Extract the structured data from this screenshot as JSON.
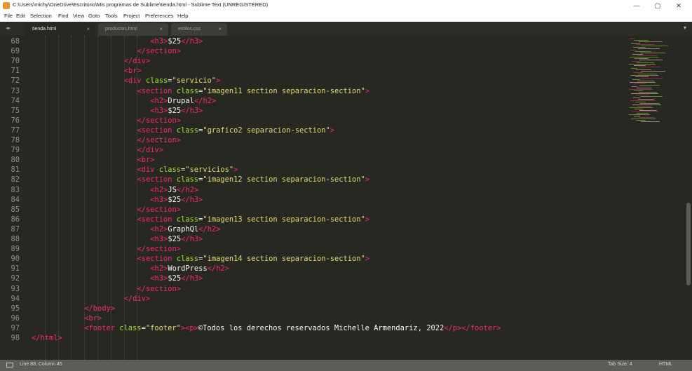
{
  "window": {
    "title": "C:\\Users\\michy\\OneDrive\\Escritorio\\Mis programas de Sublime\\tienda.html - Sublime Text (UNREGISTERED)",
    "minimize": "—",
    "maximize": "▢",
    "close": "✕"
  },
  "menu": [
    "File",
    "Edit",
    "Selection",
    "Find",
    "View",
    "Goto",
    "Tools",
    "Project",
    "Preferences",
    "Help"
  ],
  "tabs": [
    {
      "label": "tienda.html",
      "active": true
    },
    {
      "label": "productos.html",
      "active": false
    },
    {
      "label": "estilos.css",
      "active": false
    }
  ],
  "tab_close_glyph": "×",
  "tab_nav": "◂ ▸",
  "tab_menu": "▾",
  "line_numbers": [
    "68",
    "69",
    "70",
    "71",
    "72",
    "73",
    "74",
    "75",
    "76",
    "77",
    "78",
    "79",
    "80",
    "81",
    "82",
    "83",
    "84",
    "85",
    "86",
    "87",
    "88",
    "89",
    "90",
    "91",
    "92",
    "93",
    "94",
    "95",
    "96",
    "97",
    "98"
  ],
  "code_lines": [
    {
      "indent": 9,
      "tokens": [
        [
          "tg",
          "<h3>"
        ],
        [
          "tx",
          "$25"
        ],
        [
          "tg",
          "</h3>"
        ]
      ]
    },
    {
      "indent": 8,
      "tokens": [
        [
          "tg",
          "</section>"
        ]
      ]
    },
    {
      "indent": 7,
      "tokens": [
        [
          "tg",
          "</div>"
        ]
      ]
    },
    {
      "indent": 7,
      "tokens": [
        [
          "tg",
          "<br>"
        ]
      ]
    },
    {
      "indent": 7,
      "tokens": [
        [
          "tg",
          "<div "
        ],
        [
          "at",
          "class"
        ],
        [
          "tx",
          "="
        ],
        [
          "st",
          "\"servicio\""
        ],
        [
          "tg",
          ">"
        ]
      ]
    },
    {
      "indent": 8,
      "tokens": [
        [
          "tg",
          "<section "
        ],
        [
          "at",
          "class"
        ],
        [
          "tx",
          "="
        ],
        [
          "st",
          "\"imagen11 section separacion-section\""
        ],
        [
          "tg",
          ">"
        ]
      ]
    },
    {
      "indent": 9,
      "tokens": [
        [
          "tg",
          "<h2>"
        ],
        [
          "tx",
          "Drupal"
        ],
        [
          "tg",
          "</h2>"
        ]
      ]
    },
    {
      "indent": 9,
      "tokens": [
        [
          "tg",
          "<h3>"
        ],
        [
          "tx",
          "$25"
        ],
        [
          "tg",
          "</h3>"
        ]
      ]
    },
    {
      "indent": 8,
      "tokens": [
        [
          "tg",
          "</section>"
        ]
      ]
    },
    {
      "indent": 8,
      "tokens": [
        [
          "tg",
          "<section "
        ],
        [
          "at",
          "class"
        ],
        [
          "tx",
          "="
        ],
        [
          "st",
          "\"grafico2 separacion-section\""
        ],
        [
          "tg",
          ">"
        ]
      ]
    },
    {
      "indent": 8,
      "tokens": [
        [
          "tg",
          "</section>"
        ]
      ]
    },
    {
      "indent": 8,
      "tokens": [
        [
          "tg",
          "</div>"
        ]
      ]
    },
    {
      "indent": 8,
      "tokens": [
        [
          "tg",
          "<br>"
        ]
      ]
    },
    {
      "indent": 8,
      "tokens": [
        [
          "tg",
          "<div "
        ],
        [
          "at",
          "class"
        ],
        [
          "tx",
          "="
        ],
        [
          "st",
          "\"servicios\""
        ],
        [
          "tg",
          ">"
        ]
      ]
    },
    {
      "indent": 8,
      "tokens": [
        [
          "tg",
          "<section "
        ],
        [
          "at",
          "class"
        ],
        [
          "tx",
          "="
        ],
        [
          "st",
          "\"imagen12 section separacion-section\""
        ],
        [
          "tg",
          ">"
        ]
      ]
    },
    {
      "indent": 9,
      "tokens": [
        [
          "tg",
          "<h2>"
        ],
        [
          "tx",
          "JS"
        ],
        [
          "tg",
          "</h2>"
        ]
      ]
    },
    {
      "indent": 9,
      "tokens": [
        [
          "tg",
          "<h3>"
        ],
        [
          "tx",
          "$25"
        ],
        [
          "tg",
          "</h3>"
        ]
      ]
    },
    {
      "indent": 8,
      "tokens": [
        [
          "tg",
          "</section>"
        ]
      ]
    },
    {
      "indent": 8,
      "tokens": [
        [
          "tg",
          "<section "
        ],
        [
          "at",
          "class"
        ],
        [
          "tx",
          "="
        ],
        [
          "st",
          "\"imagen13 section separacion-section\""
        ],
        [
          "tg",
          ">"
        ]
      ]
    },
    {
      "indent": 9,
      "tokens": [
        [
          "tg",
          "<h2>"
        ],
        [
          "tx",
          "GraphQl"
        ],
        [
          "tg",
          "</h2>"
        ]
      ]
    },
    {
      "indent": 9,
      "tokens": [
        [
          "tg",
          "<h3>"
        ],
        [
          "tx",
          "$25"
        ],
        [
          "tg",
          "</h3>"
        ]
      ]
    },
    {
      "indent": 8,
      "tokens": [
        [
          "tg",
          "</section>"
        ]
      ]
    },
    {
      "indent": 8,
      "tokens": [
        [
          "tg",
          "<section "
        ],
        [
          "at",
          "class"
        ],
        [
          "tx",
          "="
        ],
        [
          "st",
          "\"imagen14 section separacion-section\""
        ],
        [
          "tg",
          ">"
        ]
      ]
    },
    {
      "indent": 9,
      "tokens": [
        [
          "tg",
          "<h2>"
        ],
        [
          "tx",
          "WordPress"
        ],
        [
          "tg",
          "</h2>"
        ]
      ]
    },
    {
      "indent": 9,
      "tokens": [
        [
          "tg",
          "<h3>"
        ],
        [
          "tx",
          "$25"
        ],
        [
          "tg",
          "</h3>"
        ]
      ]
    },
    {
      "indent": 8,
      "tokens": [
        [
          "tg",
          "</section>"
        ]
      ]
    },
    {
      "indent": 7,
      "tokens": [
        [
          "tg",
          "</div>"
        ]
      ]
    },
    {
      "indent": 4,
      "tokens": [
        [
          "tg",
          "</body>"
        ]
      ]
    },
    {
      "indent": 4,
      "tokens": [
        [
          "tg",
          "<br>"
        ]
      ]
    },
    {
      "indent": 4,
      "tokens": [
        [
          "tg",
          "<footer "
        ],
        [
          "at",
          "class"
        ],
        [
          "tx",
          "="
        ],
        [
          "st",
          "\"footer\""
        ],
        [
          "tg",
          "><p>"
        ],
        [
          "tx",
          "©Todos los derechos reservados Michelle Armendariz, 2022"
        ],
        [
          "tg",
          "</p></footer>"
        ]
      ]
    },
    {
      "indent": 0,
      "tokens": [
        [
          "tg",
          "</html>"
        ]
      ]
    }
  ],
  "status": {
    "position": "Line 88, Column 45",
    "tab_size": "Tab Size: 4",
    "syntax": "HTML"
  },
  "colors": {
    "background": "#272822",
    "tag": "#f92672",
    "attribute": "#a6e22e",
    "string": "#e6db74",
    "text": "#f8f8f2",
    "line_number": "#8f908a"
  }
}
